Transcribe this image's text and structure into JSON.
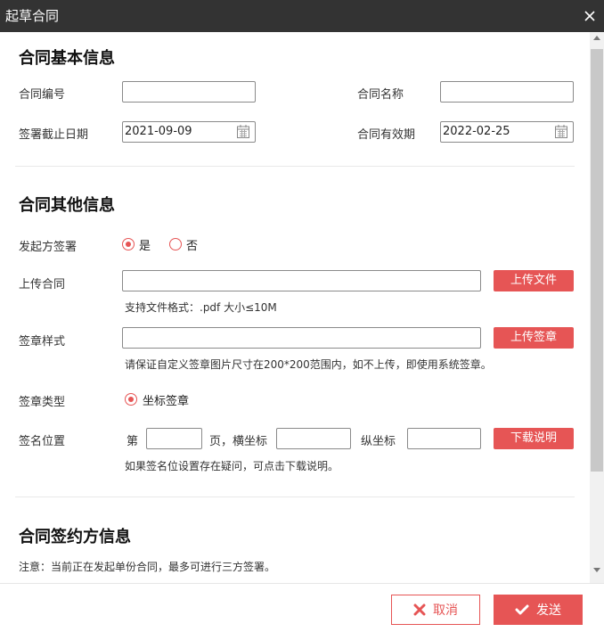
{
  "window": {
    "title": "起草合同"
  },
  "basic": {
    "title": "合同基本信息",
    "contract_no_label": "合同编号",
    "contract_no_value": "",
    "contract_name_label": "合同名称",
    "contract_name_value": "",
    "deadline_label": "签署截止日期",
    "deadline_value": "2021-09-09",
    "validity_label": "合同有效期",
    "validity_value": "2022-02-25"
  },
  "other": {
    "title": "合同其他信息",
    "initiator_sign_label": "发起方签署",
    "yes_label": "是",
    "no_label": "否",
    "upload_contract_label": "上传合同",
    "upload_file_button": "上传文件",
    "file_format_hint": "支持文件格式：.pdf 大小≤10M",
    "seal_style_label": "签章样式",
    "upload_seal_button": "上传签章",
    "seal_hint": "请保证自定义签章图片尺寸在200*200范围内，如不上传，即使用系统签章。",
    "seal_type_label": "签章类型",
    "coordinate_seal_label": "坐标签章",
    "sign_position_label": "签名位置",
    "page_prefix": "第",
    "page_suffix": "页，横坐标",
    "y_coord_label": "纵坐标",
    "download_button": "下载说明",
    "position_hint": "如果签名位设置存在疑问，可点击下载说明。"
  },
  "parties": {
    "title": "合同签约方信息",
    "note": "注意：当前正在发起单份合同，最多可进行三方签署。"
  },
  "footer": {
    "cancel_label": "取消",
    "send_label": "发送"
  }
}
